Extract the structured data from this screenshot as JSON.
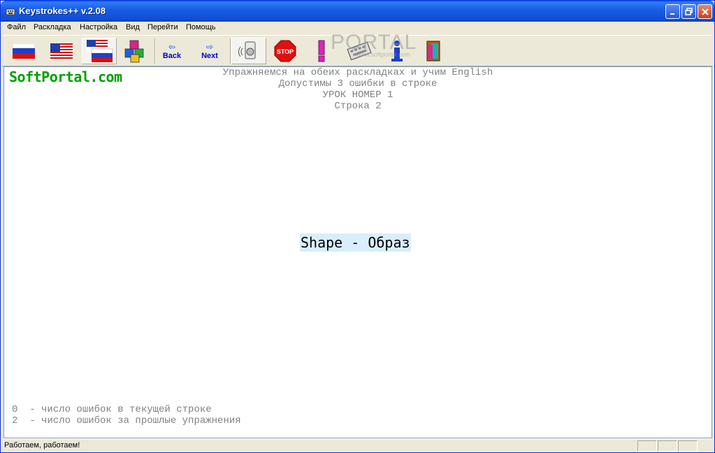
{
  "window": {
    "title": "Keystrokes++ v.2.08"
  },
  "menu": [
    "Файл",
    "Раскладка",
    "Настройка",
    "Вид",
    "Перейти",
    "Помощь"
  ],
  "toolbar": {
    "back_label": "Back",
    "next_label": "Next",
    "stop_label": "STOP"
  },
  "watermark": {
    "portal": "PORTAL",
    "url": "www.softportal.com"
  },
  "content": {
    "logo": "SoftPortal.com",
    "header_lines": [
      "Упражняемся на обеих раскладках и учим English",
      "Допустимы 3 ошибки в строке",
      "УРОК НОМЕР 1",
      "Строка 2"
    ],
    "exercise_text": "Shape - Образ",
    "stats": [
      "0  - число ошибок в текущей строке",
      "2  - число ошибок за прошлые упражнения"
    ]
  },
  "statusbar": {
    "text": "Работаем, работаем!"
  }
}
